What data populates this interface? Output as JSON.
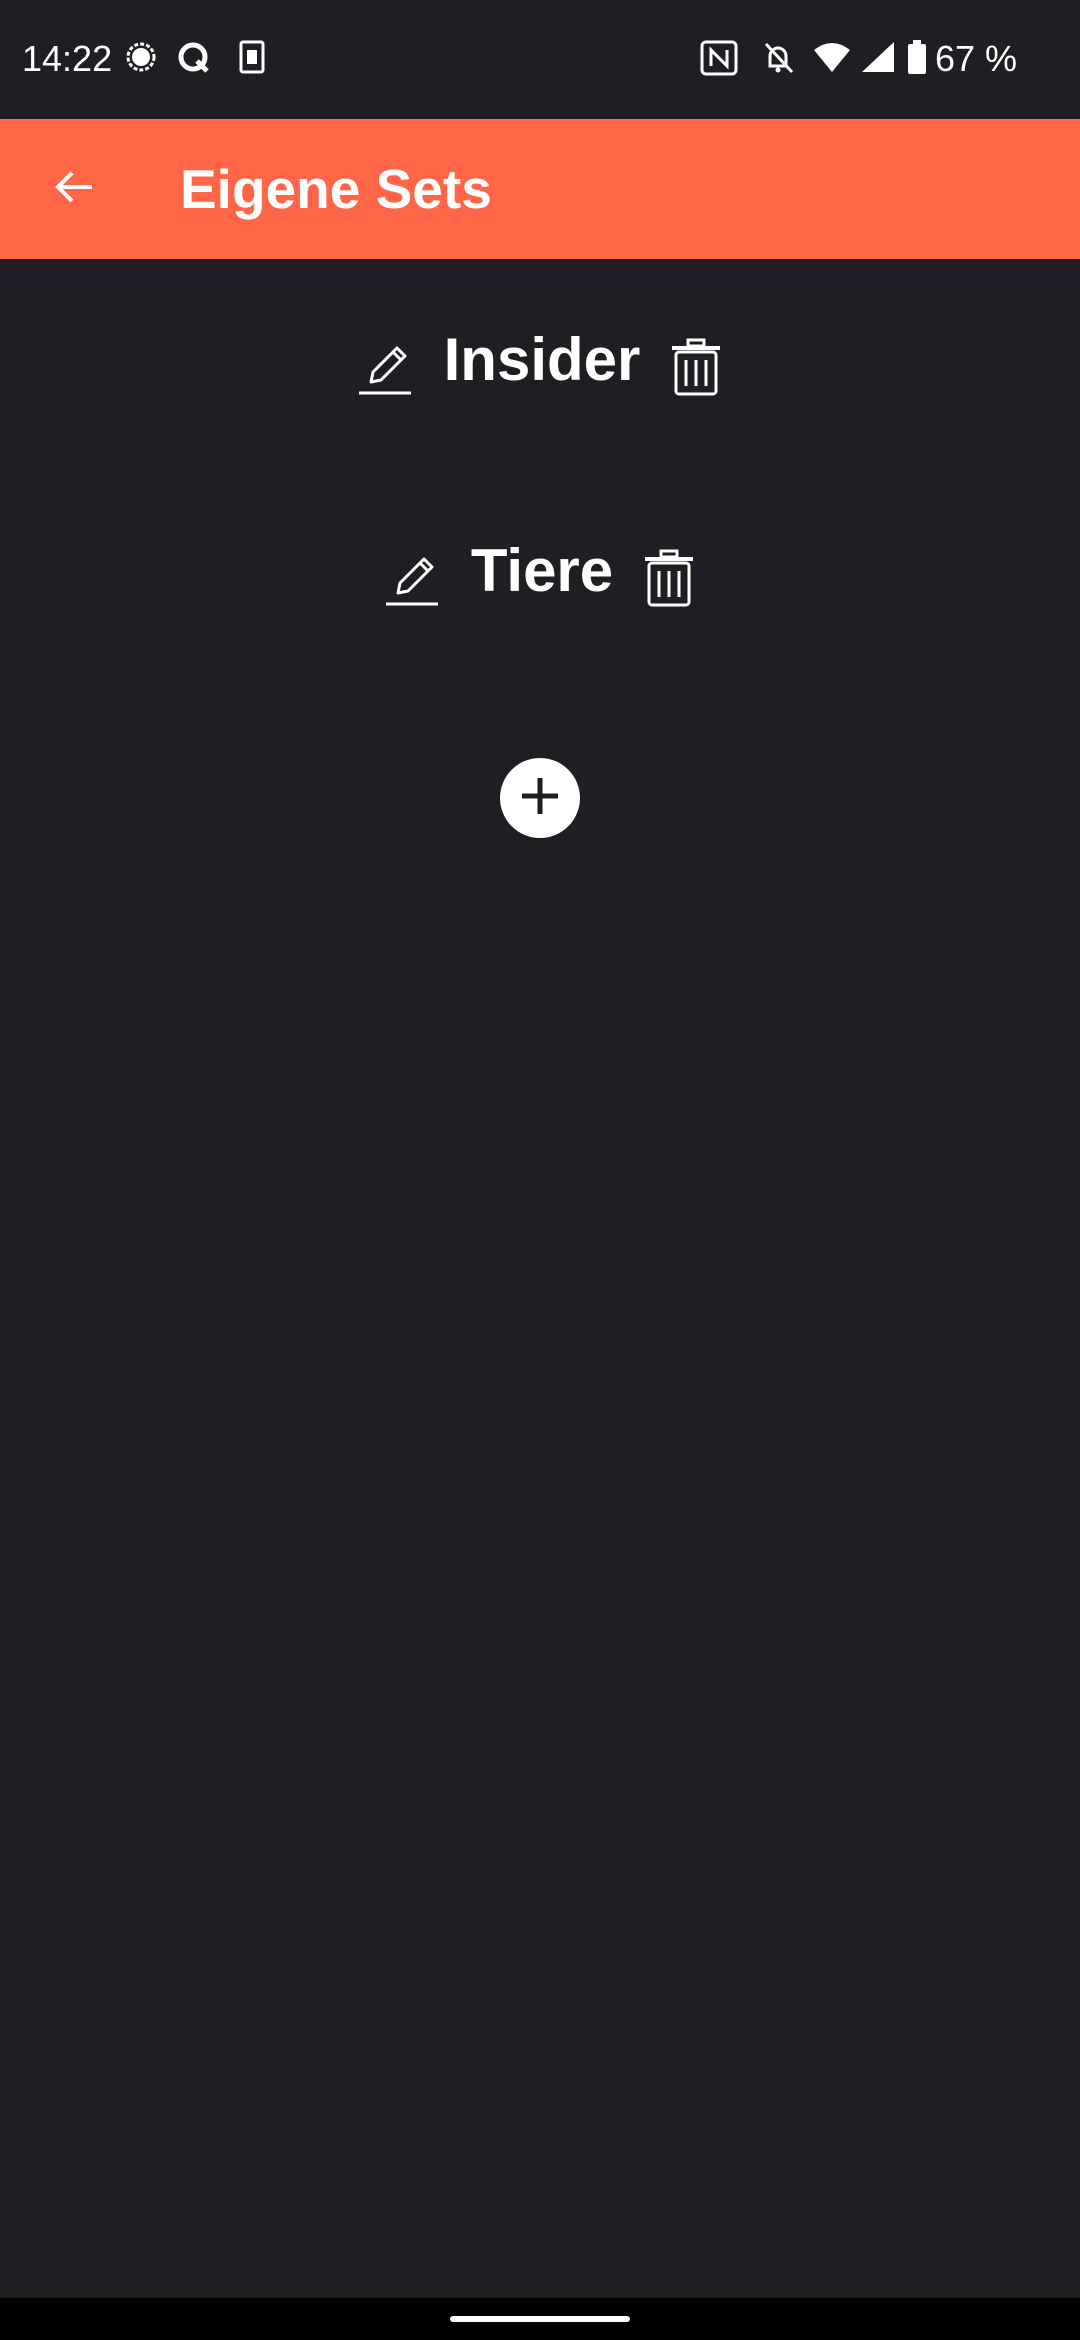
{
  "status_bar": {
    "time": "14:22",
    "battery_text": "67 %",
    "icons": [
      "signal-messenger-icon",
      "q-app-icon",
      "sim-card-icon",
      "nfc-icon",
      "notifications-muted-icon",
      "wifi-icon",
      "cell-signal-icon",
      "battery-icon"
    ]
  },
  "app_bar": {
    "title": "Eigene Sets",
    "back_icon": "arrow-back-icon",
    "background": "#ff6647"
  },
  "sets": [
    {
      "name": "Insider"
    },
    {
      "name": "Tiere"
    }
  ],
  "add_button": {
    "icon": "plus-icon"
  },
  "colors": {
    "background": "#1f1e23",
    "accent": "#ff6647",
    "text": "#ffffff"
  }
}
